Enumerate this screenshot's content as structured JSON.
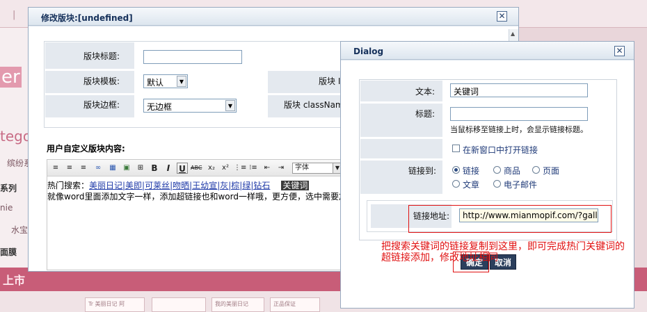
{
  "background": {
    "separator": "|",
    "sidebar_snippets": [
      "er",
      "tego",
      "缤纷系",
      "系列",
      "nie",
      "水宝",
      "面膜"
    ],
    "banner_text": "上市",
    "thumb_texts": [
      "Tr 美丽日记 阿",
      "",
      "我的美丽日记",
      "正品保证"
    ]
  },
  "main_dialog": {
    "title": "修改版块:[undefined]",
    "close_symbol": "✕",
    "form": {
      "title_label": "版块标题:",
      "title_value": "",
      "template_label": "版块模板:",
      "template_value": "默认",
      "border_label": "版块边框:",
      "border_value": "无边框",
      "id_label": "版块 ID",
      "classname_label": "版块 className"
    },
    "content_label": "用户自定义版块内容:",
    "toolbar": {
      "buttons": [
        "≡",
        "≡",
        "≡",
        "∞",
        "▦",
        "▣",
        "⊞",
        "B",
        "I",
        "U",
        "ABC",
        "x₂",
        "x²",
        "⋮≡",
        "⁝≡",
        "⇤",
        "⇥"
      ],
      "font_label": "字体"
    },
    "editor": {
      "line1_prefix": "热门搜索：",
      "line1_links": "美丽日记|美即|可莱丝|吻晒|王幼宣|灰|棕|绿|钻石",
      "line1_selected": "关键词",
      "line2": "就像word里面添加文字一样，添加超链接也和word一样哦，更方便，选中需要加链接"
    }
  },
  "link_dialog": {
    "title": "Dialog",
    "close_symbol": "✕",
    "text_label": "文本:",
    "text_value": "关键词",
    "tooltip_label": "标题:",
    "tooltip_value": "",
    "tooltip_hint": "当鼠标移至链接上时，会显示链接标题。",
    "new_window_label": "在新窗口中打开链接",
    "link_to_label": "链接到:",
    "link_types": [
      "链接",
      "商品",
      "页面",
      "文章",
      "电子邮件"
    ],
    "selected_type": "链接",
    "address_label": "链接地址:",
    "address_value": "http://www.mianmopif.com/?gallery--",
    "ok_label": "确定",
    "cancel_label": "取消"
  },
  "annotation": {
    "line1": "把搜索关键词的链接复制到这里，即可完成热门关键词的",
    "line2": "超链接添加，修改地址相同",
    "color": "#e01010"
  }
}
